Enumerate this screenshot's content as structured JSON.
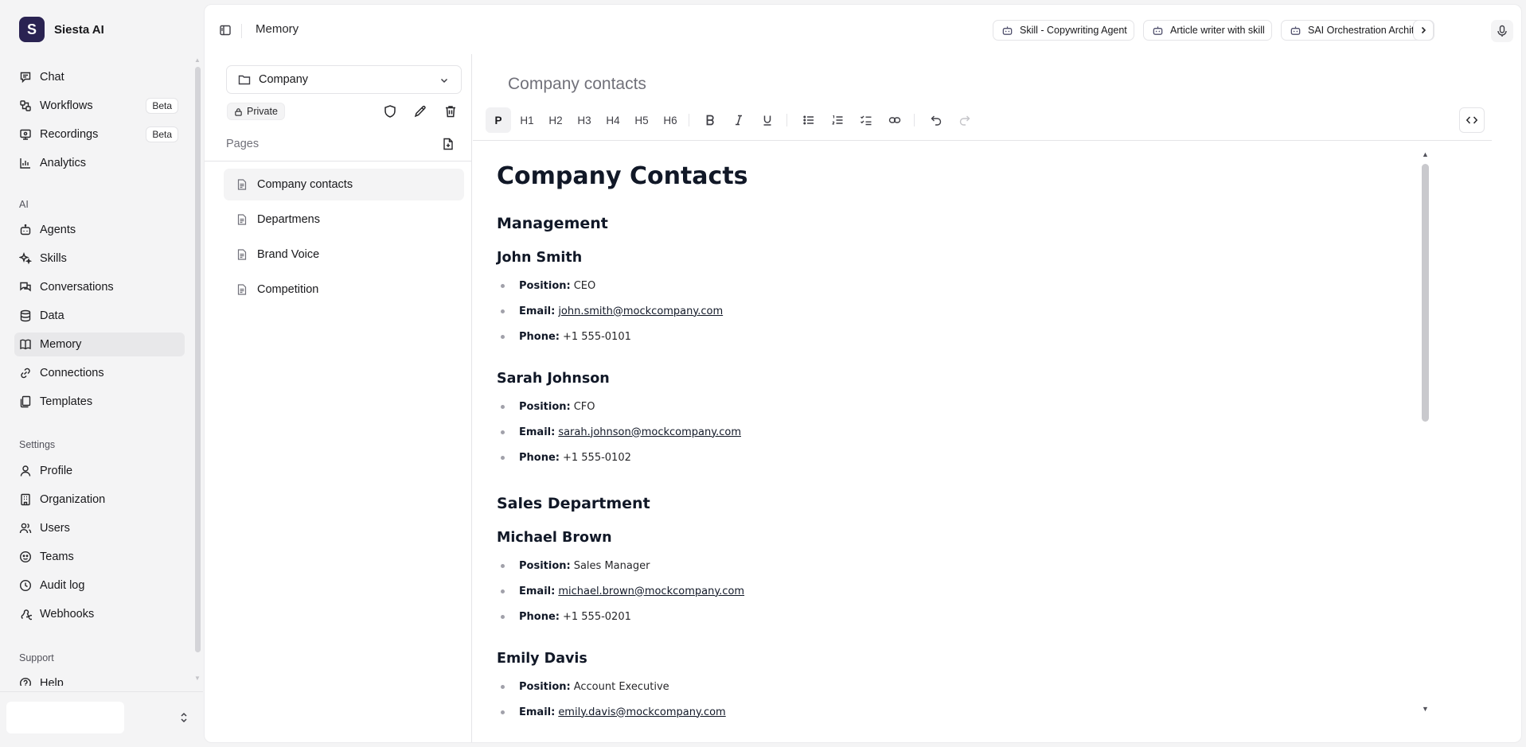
{
  "brand": {
    "name": "Siesta AI",
    "logo_letter": "S"
  },
  "sidebar": {
    "main_items": [
      {
        "label": "Chat",
        "icon": "chat-icon"
      },
      {
        "label": "Workflows",
        "icon": "workflow-icon",
        "badge": "Beta"
      },
      {
        "label": "Recordings",
        "icon": "recording-icon",
        "badge": "Beta"
      },
      {
        "label": "Analytics",
        "icon": "chart-icon"
      }
    ],
    "ai_section": "AI",
    "ai_items": [
      {
        "label": "Agents",
        "icon": "bot-icon"
      },
      {
        "label": "Skills",
        "icon": "sparkles-icon"
      },
      {
        "label": "Conversations",
        "icon": "conversations-icon"
      },
      {
        "label": "Data",
        "icon": "database-icon"
      },
      {
        "label": "Memory",
        "icon": "book-icon",
        "active": true
      },
      {
        "label": "Connections",
        "icon": "link-icon"
      },
      {
        "label": "Templates",
        "icon": "templates-icon"
      }
    ],
    "settings_section": "Settings",
    "settings_items": [
      {
        "label": "Profile",
        "icon": "user-icon"
      },
      {
        "label": "Organization",
        "icon": "building-icon"
      },
      {
        "label": "Users",
        "icon": "users-icon"
      },
      {
        "label": "Teams",
        "icon": "teams-icon"
      },
      {
        "label": "Audit log",
        "icon": "audit-icon"
      },
      {
        "label": "Webhooks",
        "icon": "webhook-icon"
      }
    ],
    "support_section": "Support",
    "support_items": [
      {
        "label": "Help",
        "icon": "help-icon"
      }
    ]
  },
  "header": {
    "title": "Memory",
    "agents": [
      "Skill - Copywriting Agent",
      "Article writer with skill",
      "SAI Orchestration Architect"
    ]
  },
  "memory": {
    "folder": "Company",
    "visibility": "Private",
    "pages_label": "Pages",
    "pages": [
      "Company contacts",
      "Departmens",
      "Brand Voice",
      "Competition"
    ],
    "active_page": "Company contacts"
  },
  "editor": {
    "title": "Company contacts",
    "toolbar": {
      "block_types": [
        "P",
        "H1",
        "H2",
        "H3",
        "H4",
        "H5",
        "H6"
      ],
      "active_block": "P"
    },
    "doc": {
      "title": "Company Contacts",
      "sections": [
        {
          "heading": "Management",
          "people": [
            {
              "name": "John Smith",
              "position": "CEO",
              "email": "john.smith@mockcompany.com",
              "phone": "+1 555-0101"
            },
            {
              "name": "Sarah Johnson",
              "position": "CFO",
              "email": "sarah.johnson@mockcompany.com",
              "phone": "+1 555-0102"
            }
          ]
        },
        {
          "heading": "Sales Department",
          "people": [
            {
              "name": "Michael Brown",
              "position": "Sales Manager",
              "email": "michael.brown@mockcompany.com",
              "phone": "+1 555-0201"
            },
            {
              "name": "Emily Davis",
              "position": "Account Executive",
              "email": "emily.davis@mockcompany.com"
            }
          ]
        }
      ],
      "field_labels": {
        "position": "Position:",
        "email": "Email:",
        "phone": "Phone:"
      }
    }
  }
}
